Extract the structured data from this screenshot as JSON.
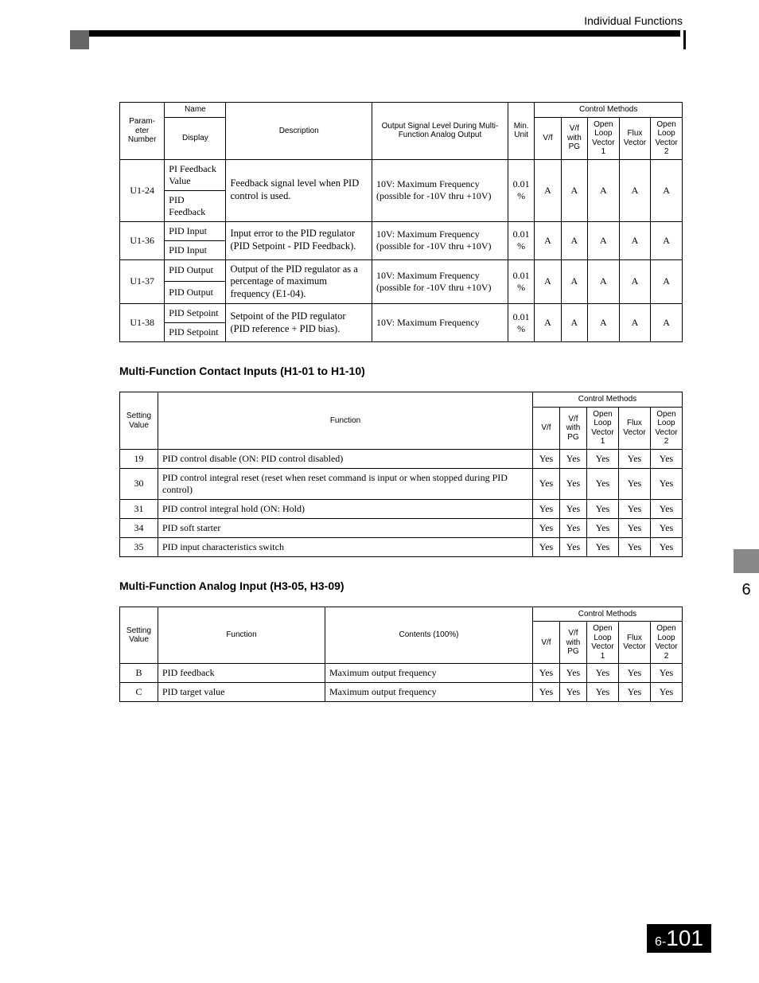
{
  "page_header": "Individual Functions",
  "chapter_tab": "6",
  "page_number_prefix": "6-",
  "page_number": "101",
  "t1": {
    "head": {
      "param": "Param-\neter\nNumber",
      "name": "Name",
      "display": "Display",
      "desc": "Description",
      "output": "Output Signal Level During Multi-Function Analog Output",
      "min": "Min.\nUnit",
      "cm": "Control Methods",
      "vf": "V/f",
      "vfpg": "V/f with PG",
      "olv1": "Open Loop Vector 1",
      "flux": "Flux Vector",
      "olv2": "Open Loop Vector 2"
    },
    "rows": [
      {
        "param": "U1-24",
        "names": [
          "PI Feedback Value",
          "PID Feedback"
        ],
        "desc": "Feedback signal level when PID control is used.",
        "out1": "10V: Maximum Frequency",
        "out2": "(possible for -10V thru +10V)",
        "min": "0.01 %",
        "m": [
          "A",
          "A",
          "A",
          "A",
          "A"
        ]
      },
      {
        "param": "U1-36",
        "names": [
          "PID Input",
          "PID Input"
        ],
        "desc": "Input error to the PID regulator (PID Setpoint - PID Feedback).",
        "out1": "10V: Maximum Frequency",
        "out2": "(possible for -10V thru +10V)",
        "min": "0.01 %",
        "m": [
          "A",
          "A",
          "A",
          "A",
          "A"
        ]
      },
      {
        "param": "U1-37",
        "names": [
          "PID Output",
          "PID Output"
        ],
        "desc": "Output of the PID regulator as a percentage of maximum frequency (E1-04).",
        "out1": "10V: Maximum Frequency",
        "out2": "(possible for -10V thru +10V)",
        "min": "0.01 %",
        "m": [
          "A",
          "A",
          "A",
          "A",
          "A"
        ]
      },
      {
        "param": "U1-38",
        "names": [
          "PID Setpoint",
          "PID Setpoint"
        ],
        "desc": "Setpoint of the PID regulator (PID reference + PID bias).",
        "out1": "10V: Maximum Frequency",
        "out2": "",
        "min": "0.01 %",
        "m": [
          "A",
          "A",
          "A",
          "A",
          "A"
        ]
      }
    ]
  },
  "section2_title": "Multi-Function Contact Inputs (H1-01 to H1-10)",
  "t2": {
    "head": {
      "sv": "Setting Value",
      "func": "Function",
      "cm": "Control Methods",
      "vf": "V/f",
      "vfpg": "V/f with PG",
      "olv1": "Open Loop Vector 1",
      "flux": "Flux Vector",
      "olv2": "Open Loop Vector 2"
    },
    "rows": [
      {
        "sv": "19",
        "func": "PID control disable (ON: PID control disabled)",
        "m": [
          "Yes",
          "Yes",
          "Yes",
          "Yes",
          "Yes"
        ]
      },
      {
        "sv": "30",
        "func": "PID control integral reset (reset when reset command is input or when stopped during PID control)",
        "m": [
          "Yes",
          "Yes",
          "Yes",
          "Yes",
          "Yes"
        ]
      },
      {
        "sv": "31",
        "func": "PID control integral hold (ON: Hold)",
        "m": [
          "Yes",
          "Yes",
          "Yes",
          "Yes",
          "Yes"
        ]
      },
      {
        "sv": "34",
        "func": "PID soft starter",
        "m": [
          "Yes",
          "Yes",
          "Yes",
          "Yes",
          "Yes"
        ]
      },
      {
        "sv": "35",
        "func": "PID input characteristics switch",
        "m": [
          "Yes",
          "Yes",
          "Yes",
          "Yes",
          "Yes"
        ]
      }
    ]
  },
  "section3_title": "Multi-Function Analog Input (H3-05, H3-09)",
  "t3": {
    "head": {
      "sv": "Setting Value",
      "func": "Function",
      "contents": "Contents (100%)",
      "cm": "Control Methods",
      "vf": "V/f",
      "vfpg": "V/f with PG",
      "olv1": "Open Loop Vector 1",
      "flux": "Flux Vector",
      "olv2": "Open Loop Vector 2"
    },
    "rows": [
      {
        "sv": "B",
        "func": "PID feedback",
        "contents": "Maximum output frequency",
        "m": [
          "Yes",
          "Yes",
          "Yes",
          "Yes",
          "Yes"
        ]
      },
      {
        "sv": "C",
        "func": "PID target value",
        "contents": "Maximum output frequency",
        "m": [
          "Yes",
          "Yes",
          "Yes",
          "Yes",
          "Yes"
        ]
      }
    ]
  }
}
